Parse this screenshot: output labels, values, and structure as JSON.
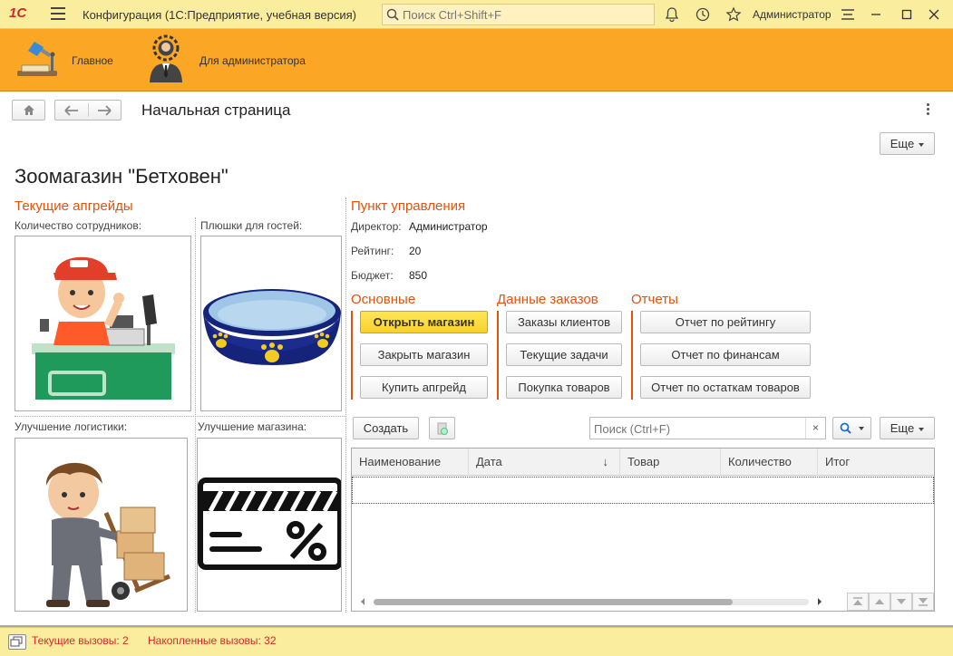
{
  "titlebar": {
    "logo": "1С",
    "title": "Конфигурация  (1С:Предприятие, учебная версия)",
    "search_placeholder": "Поиск Ctrl+Shift+F",
    "user": "Администратор"
  },
  "sections": [
    {
      "label": "Главное",
      "icon": "desk-lamp-icon"
    },
    {
      "label": "Для администратора",
      "icon": "admin-gear-icon"
    }
  ],
  "page": {
    "title": "Начальная страница",
    "more_label": "Еще",
    "heading": "Зоомагазин \"Бетховен\""
  },
  "upgrades": {
    "title": "Текущие апгрейды",
    "items": [
      {
        "label": "Количество сотрудников:",
        "picture": "cashier-picture"
      },
      {
        "label": "Плюшки для гостей:",
        "picture": "pet-bowl-picture"
      },
      {
        "label": "Улучшение логистики:",
        "picture": "loader-picture"
      },
      {
        "label": "Улучшение магазина:",
        "picture": "discount-card-picture"
      }
    ]
  },
  "control": {
    "title": "Пункт управления",
    "director_label": "Директор:",
    "director_value": "Администратор",
    "rating_label": "Рейтинг:",
    "rating_value": "20",
    "budget_label": "Бюджет:",
    "budget_value": "850"
  },
  "groups": {
    "main": {
      "title": "Основные",
      "buttons": [
        "Открыть магазин",
        "Закрыть магазин",
        "Купить апгрейд"
      ]
    },
    "orders": {
      "title": "Данные заказов",
      "buttons": [
        "Заказы клиентов",
        "Текущие задачи",
        "Покупка товаров"
      ]
    },
    "reports": {
      "title": "Отчеты",
      "buttons": [
        "Отчет по рейтингу",
        "Отчет по финансам",
        "Отчет по остаткам товаров"
      ]
    }
  },
  "list": {
    "create_label": "Создать",
    "search_placeholder": "Поиск (Ctrl+F)",
    "clear_label": "×",
    "more_label": "Еще",
    "columns": [
      "Наименование",
      "Дата",
      "Товар",
      "Количество",
      "Итог"
    ],
    "sort_indicator": "↓"
  },
  "statusbar": {
    "current_calls": "Текущие вызовы: 2",
    "accumulated_calls": "Накопленные вызовы: 32"
  },
  "colors": {
    "titlebar": "#fbed9e",
    "sections": "#fba624",
    "accent": "#e2520b",
    "primary_button": "#f8d22b"
  }
}
